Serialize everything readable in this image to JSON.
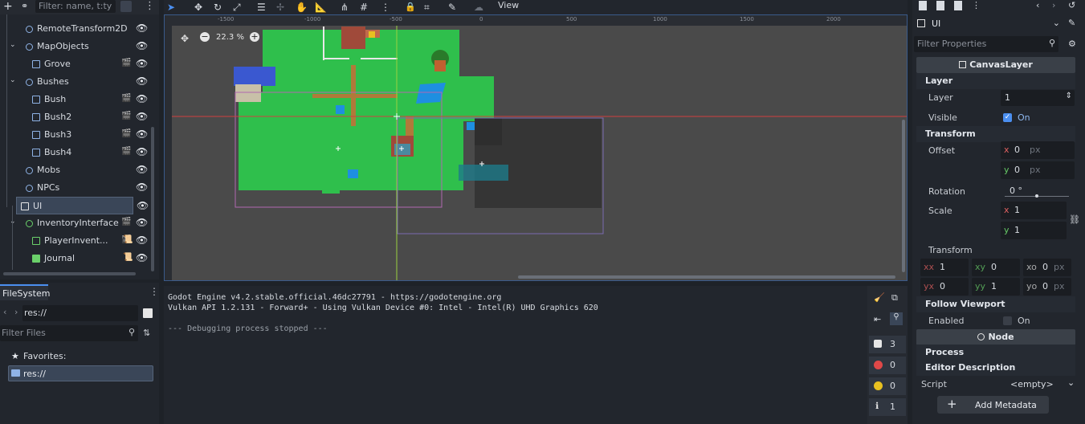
{
  "scene": {
    "filter_placeholder": "Filter: name, t:ty",
    "nodes": [
      {
        "label": "RemoteTransform2D"
      },
      {
        "label": "MapObjects"
      },
      {
        "label": "Grove"
      },
      {
        "label": "Bushes"
      },
      {
        "label": "Bush"
      },
      {
        "label": "Bush2"
      },
      {
        "label": "Bush3"
      },
      {
        "label": "Bush4"
      },
      {
        "label": "Mobs"
      },
      {
        "label": "NPCs"
      },
      {
        "label": "UI"
      },
      {
        "label": "InventoryInterface"
      },
      {
        "label": "PlayerInvent..."
      },
      {
        "label": "Journal"
      }
    ]
  },
  "filesystem": {
    "tab": "FileSystem",
    "path": "res://",
    "filter_placeholder": "Filter Files",
    "favorites": "Favorites:",
    "root": "res://"
  },
  "viewport": {
    "view_menu": "View",
    "zoom": "22.3 %",
    "ruler": [
      "-1500",
      "-1000",
      "-500",
      "0",
      "500",
      "1000",
      "1500",
      "2000",
      "2500",
      "3000"
    ]
  },
  "output": {
    "lines": [
      "Godot Engine v4.2.stable.official.46dc27791 - https://godotengine.org",
      "Vulkan API 1.2.131 - Forward+ - Using Vulkan Device #0: Intel - Intel(R) UHD Graphics 620",
      "",
      "--- Debugging process stopped ---"
    ],
    "counts": {
      "messages": "3",
      "errors": "0",
      "warnings": "0",
      "info": "1"
    }
  },
  "inspector": {
    "node_name": "UI",
    "filter_placeholder": "Filter Properties",
    "class": "CanvasLayer",
    "layer_section": "Layer",
    "layer_label": "Layer",
    "layer_value": "1",
    "visible_label": "Visible",
    "visible_value": "On",
    "transform_section": "Transform",
    "offset_label": "Offset",
    "offset_x": "0",
    "offset_y": "0",
    "px": "px",
    "rotation_label": "Rotation",
    "rotation_value": "0 °",
    "scale_label": "Scale",
    "scale_x": "1",
    "scale_y": "1",
    "transform_label": "Transform",
    "xx": "1",
    "xy": "0",
    "xo": "0",
    "yx": "0",
    "yy": "1",
    "yo": "0",
    "follow_section": "Follow Viewport",
    "enabled_label": "Enabled",
    "enabled_value": "On",
    "node_class": "Node",
    "process": "Process",
    "editor_description": "Editor Description",
    "script_label": "Script",
    "script_value": "<empty>",
    "add_metadata": "Add Metadata"
  },
  "colors": {
    "accent": "#4b8ff0",
    "grass": "#2fbf4c",
    "water": "#1e8fe0",
    "bg": "#22262d"
  }
}
